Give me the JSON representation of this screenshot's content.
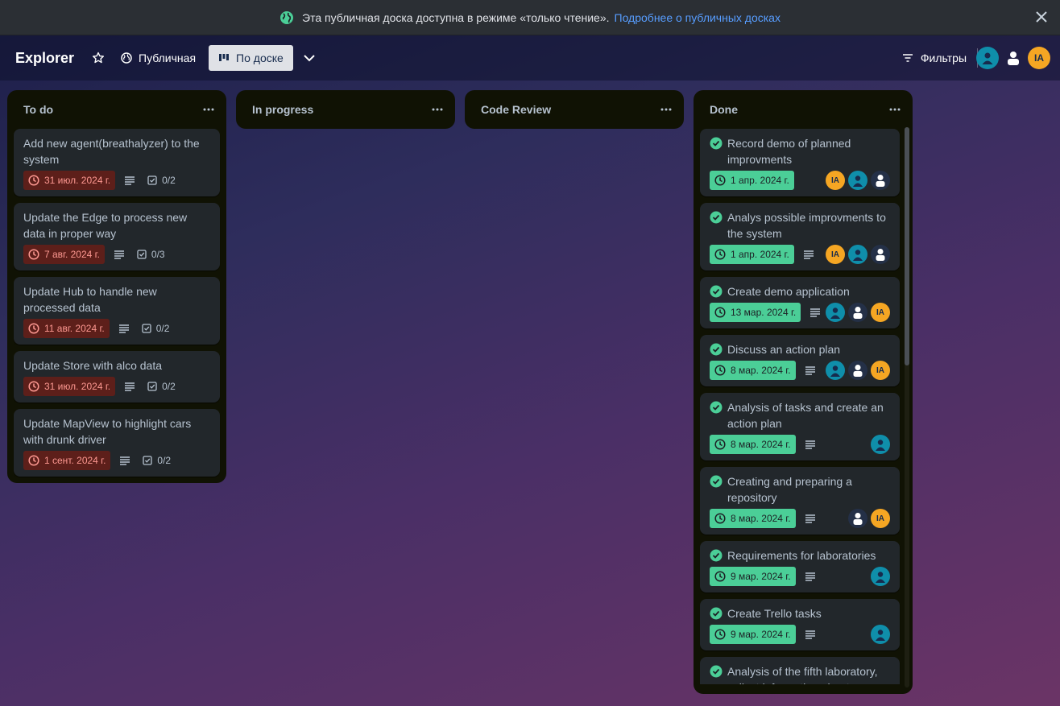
{
  "banner": {
    "text": "Эта публичная доска доступна в режиме «только чтение».",
    "link": "Подробнее о публичных досках"
  },
  "header": {
    "title": "Explorer",
    "visibility": "Публичная",
    "view": "По доске",
    "filters": "Фильтры",
    "avatar_initials": "IA"
  },
  "colors": {
    "overdue_bg": "#5d1f1a",
    "overdue_text": "#fd9891",
    "complete_bg": "#4bce97",
    "list_bg": "#101204",
    "card_bg": "#22272b",
    "avatar_orange": "#f5a623",
    "avatar_teal": "#0f8eaa"
  },
  "lists": [
    {
      "title": "To do",
      "cards": [
        {
          "title": "Add new agent(breathalyzer) to the system",
          "date": "31 июл. 2024 г.",
          "checklist": "0/2"
        },
        {
          "title": "Update the Edge to process new data in proper way",
          "date": "7 авг. 2024 г.",
          "checklist": "0/3"
        },
        {
          "title": "Update Hub to handle new processed data",
          "date": "11 авг. 2024 г.",
          "checklist": "0/2"
        },
        {
          "title": "Update Store with alco data",
          "date": "31 июл. 2024 г.",
          "checklist": "0/2"
        },
        {
          "title": "Update MapView to highlight cars with drunk driver",
          "date": "1 сент. 2024 г.",
          "checklist": "0/2"
        }
      ]
    },
    {
      "title": "In progress",
      "cards": []
    },
    {
      "title": "Code Review",
      "cards": []
    },
    {
      "title": "Done",
      "cards": [
        {
          "title": "Record demo of planned improvments",
          "date": "1 апр. 2024 г."
        },
        {
          "title": "Analys possible improvments to the system",
          "date": "1 апр. 2024 г."
        },
        {
          "title": "Create demo application",
          "date": "13 мар. 2024 г."
        },
        {
          "title": "Discuss an action plan",
          "date": "8 мар. 2024 г."
        },
        {
          "title": "Analysis of tasks and create an action plan",
          "date": "8 мар. 2024 г."
        },
        {
          "title": "Creating and preparing a repository",
          "date": "8 мар. 2024 г."
        },
        {
          "title": "Requirements for laboratories",
          "date": "9 мар. 2024 г."
        },
        {
          "title": "Create Trello tasks",
          "date": "9 мар. 2024 г."
        },
        {
          "title": "Analysis of the fifth laboratory, collect information about",
          "date": ""
        }
      ]
    }
  ]
}
